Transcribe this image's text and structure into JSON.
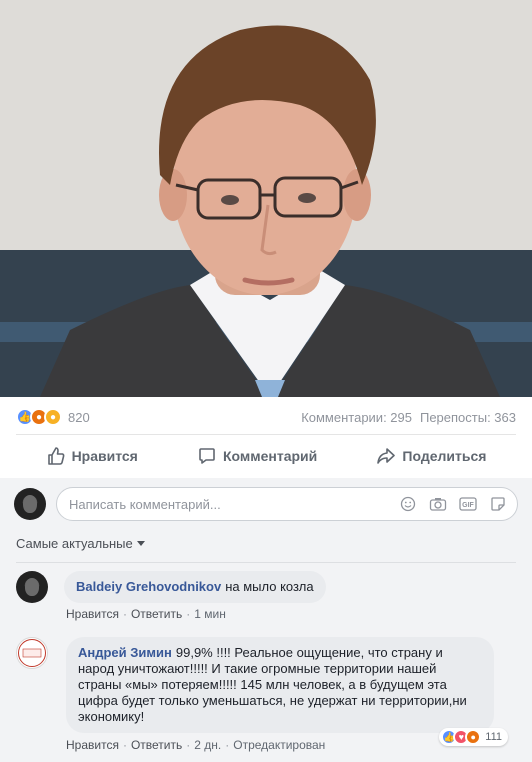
{
  "post": {
    "reaction_count": "820",
    "comments_label": "Комментарии: 295",
    "shares_label": "Перепосты: 363",
    "reaction_icons": [
      "like-icon",
      "angry-icon",
      "wow-icon"
    ]
  },
  "actions": {
    "like": "Нравится",
    "comment": "Комментарий",
    "share": "Поделиться"
  },
  "composer": {
    "placeholder": "Написать комментарий...",
    "icons": [
      "emoji-icon",
      "camera-icon",
      "gif-icon",
      "sticker-icon"
    ]
  },
  "sort": {
    "label": "Самые актуальные"
  },
  "comments": [
    {
      "author": "Baldeiy Grehovodnikov",
      "text": "на мыло козла",
      "like": "Нравится",
      "reply": "Ответить",
      "time": "1 мин"
    },
    {
      "author": "Андрей Зимин",
      "text": "99,9% !!!! Реальное ощущение, что страну и народ уничтожают!!!!! И такие огромные территории нашей страны «мы» потеряем!!!!! 145 млн человек, а в будущем эта цифра будет только уменьшаться, не удержат ни территории,ни экономику!",
      "like": "Нравится",
      "reply": "Ответить",
      "time": "2 дн.",
      "edited": "Отредактирован",
      "reaction_count": "111",
      "avatar_text": [
        "ПРОСТО",
        "О",
        "ВАЖНОМ"
      ]
    }
  ],
  "colors": {
    "author_link": "#385898",
    "like_blue": "#5890ff",
    "angry_orange": "#e9710f",
    "wow_yellow": "#f7b125",
    "comments_bg": "#f2f3f5"
  }
}
